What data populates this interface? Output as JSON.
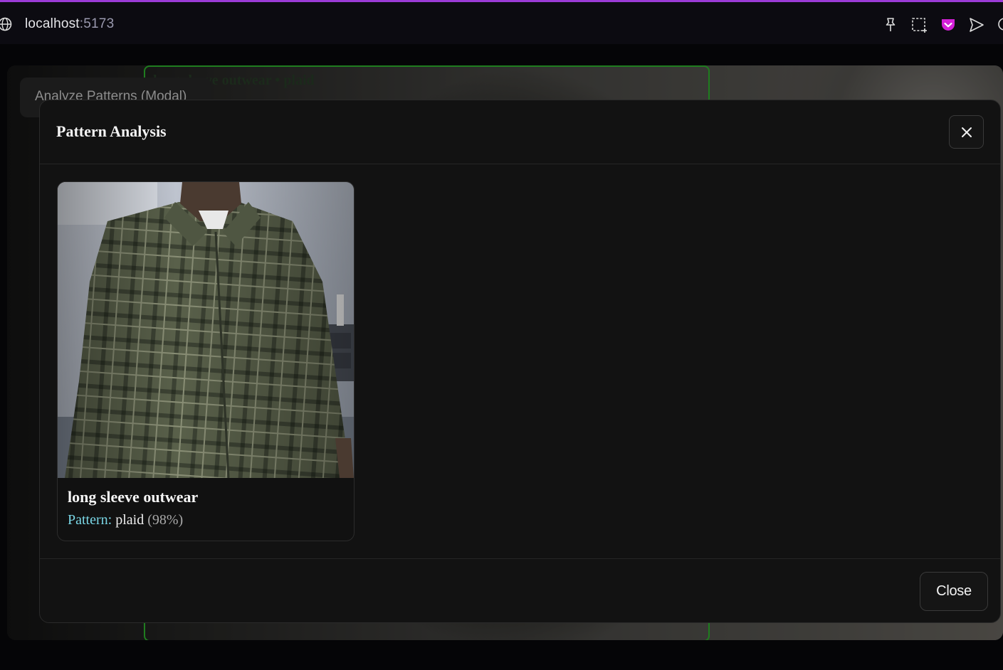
{
  "browser": {
    "url_host": "localhost",
    "url_port": ":5173",
    "accent_color": "#9b3bd6",
    "icons": [
      "globe-icon",
      "pin-icon",
      "screenshot-icon",
      "pocket-icon",
      "send-icon",
      "chat-icon"
    ]
  },
  "app": {
    "analyze_button_label": "Analyze Patterns (Modal)",
    "detection_label": "long sleeve outwear • plaid",
    "detection_box_color": "#1f7d1f"
  },
  "modal": {
    "title": "Pattern Analysis",
    "close_icon": "close-icon",
    "items": [
      {
        "name": "long sleeve outwear",
        "pattern_label": "Pattern:",
        "pattern_value": "plaid",
        "confidence": "(98%)"
      }
    ],
    "footer_close_label": "Close"
  }
}
